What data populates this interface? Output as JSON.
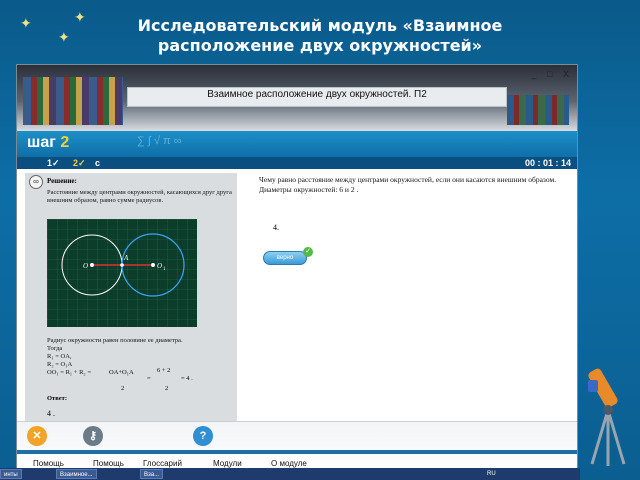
{
  "slide": {
    "title_line1": "Исследовательский модуль «Взаимное",
    "title_line2": "расположение двух окружностей»"
  },
  "window": {
    "title": "Взаимное расположение двух окружностей. П2",
    "controls": "_ □ X"
  },
  "banner": {
    "step_word": "шаг",
    "step_number": "2"
  },
  "nav": {
    "item1": "1✓",
    "item2": "2✓",
    "item3": "c",
    "timer": "00 : 01 : 14"
  },
  "solution": {
    "icon_label": "∞",
    "title": "Решение:",
    "text": "Расстояние между центрами окружностей, касающихся друг друга внешним образом, равно сумме радиусов.",
    "point_o": "O",
    "point_a": "A",
    "point_o1": "O",
    "point_o1_sub": "1",
    "formula_lines": [
      "Радиус окружности равен половине ее диаметра.",
      "Тогда",
      "R₁ = OA,",
      "R₂ = O₁A",
      "OO₁ = R₁ + R₂ ="
    ],
    "frac1_num": "OA+O₁A",
    "frac1_den": "2",
    "frac2_num": "6 + 2",
    "frac2_den": "2",
    "eq_sign1": "=",
    "eq_sign2": "= 4 .",
    "answer_label": "Ответ:",
    "answer_value": "4 ."
  },
  "question": {
    "text": "Чему равно расстояние между центрами окружностей, если они касаются внешним образом.",
    "diameters": "Диаметры окружностей:  6  и  2  .",
    "user_answer": "4.",
    "check_button": "верно",
    "check_mark": "✓"
  },
  "bottom": {
    "icon_exit": "✕",
    "icon_key": "⚷",
    "icon_help": "?",
    "menu": [
      "Помощь",
      "Помощь",
      "Глоссарий",
      "Модули",
      "О модуле"
    ]
  },
  "taskbar": {
    "item1": "инты",
    "item2": "Взаимное...",
    "item3": "Вза...",
    "tray": "RU"
  }
}
